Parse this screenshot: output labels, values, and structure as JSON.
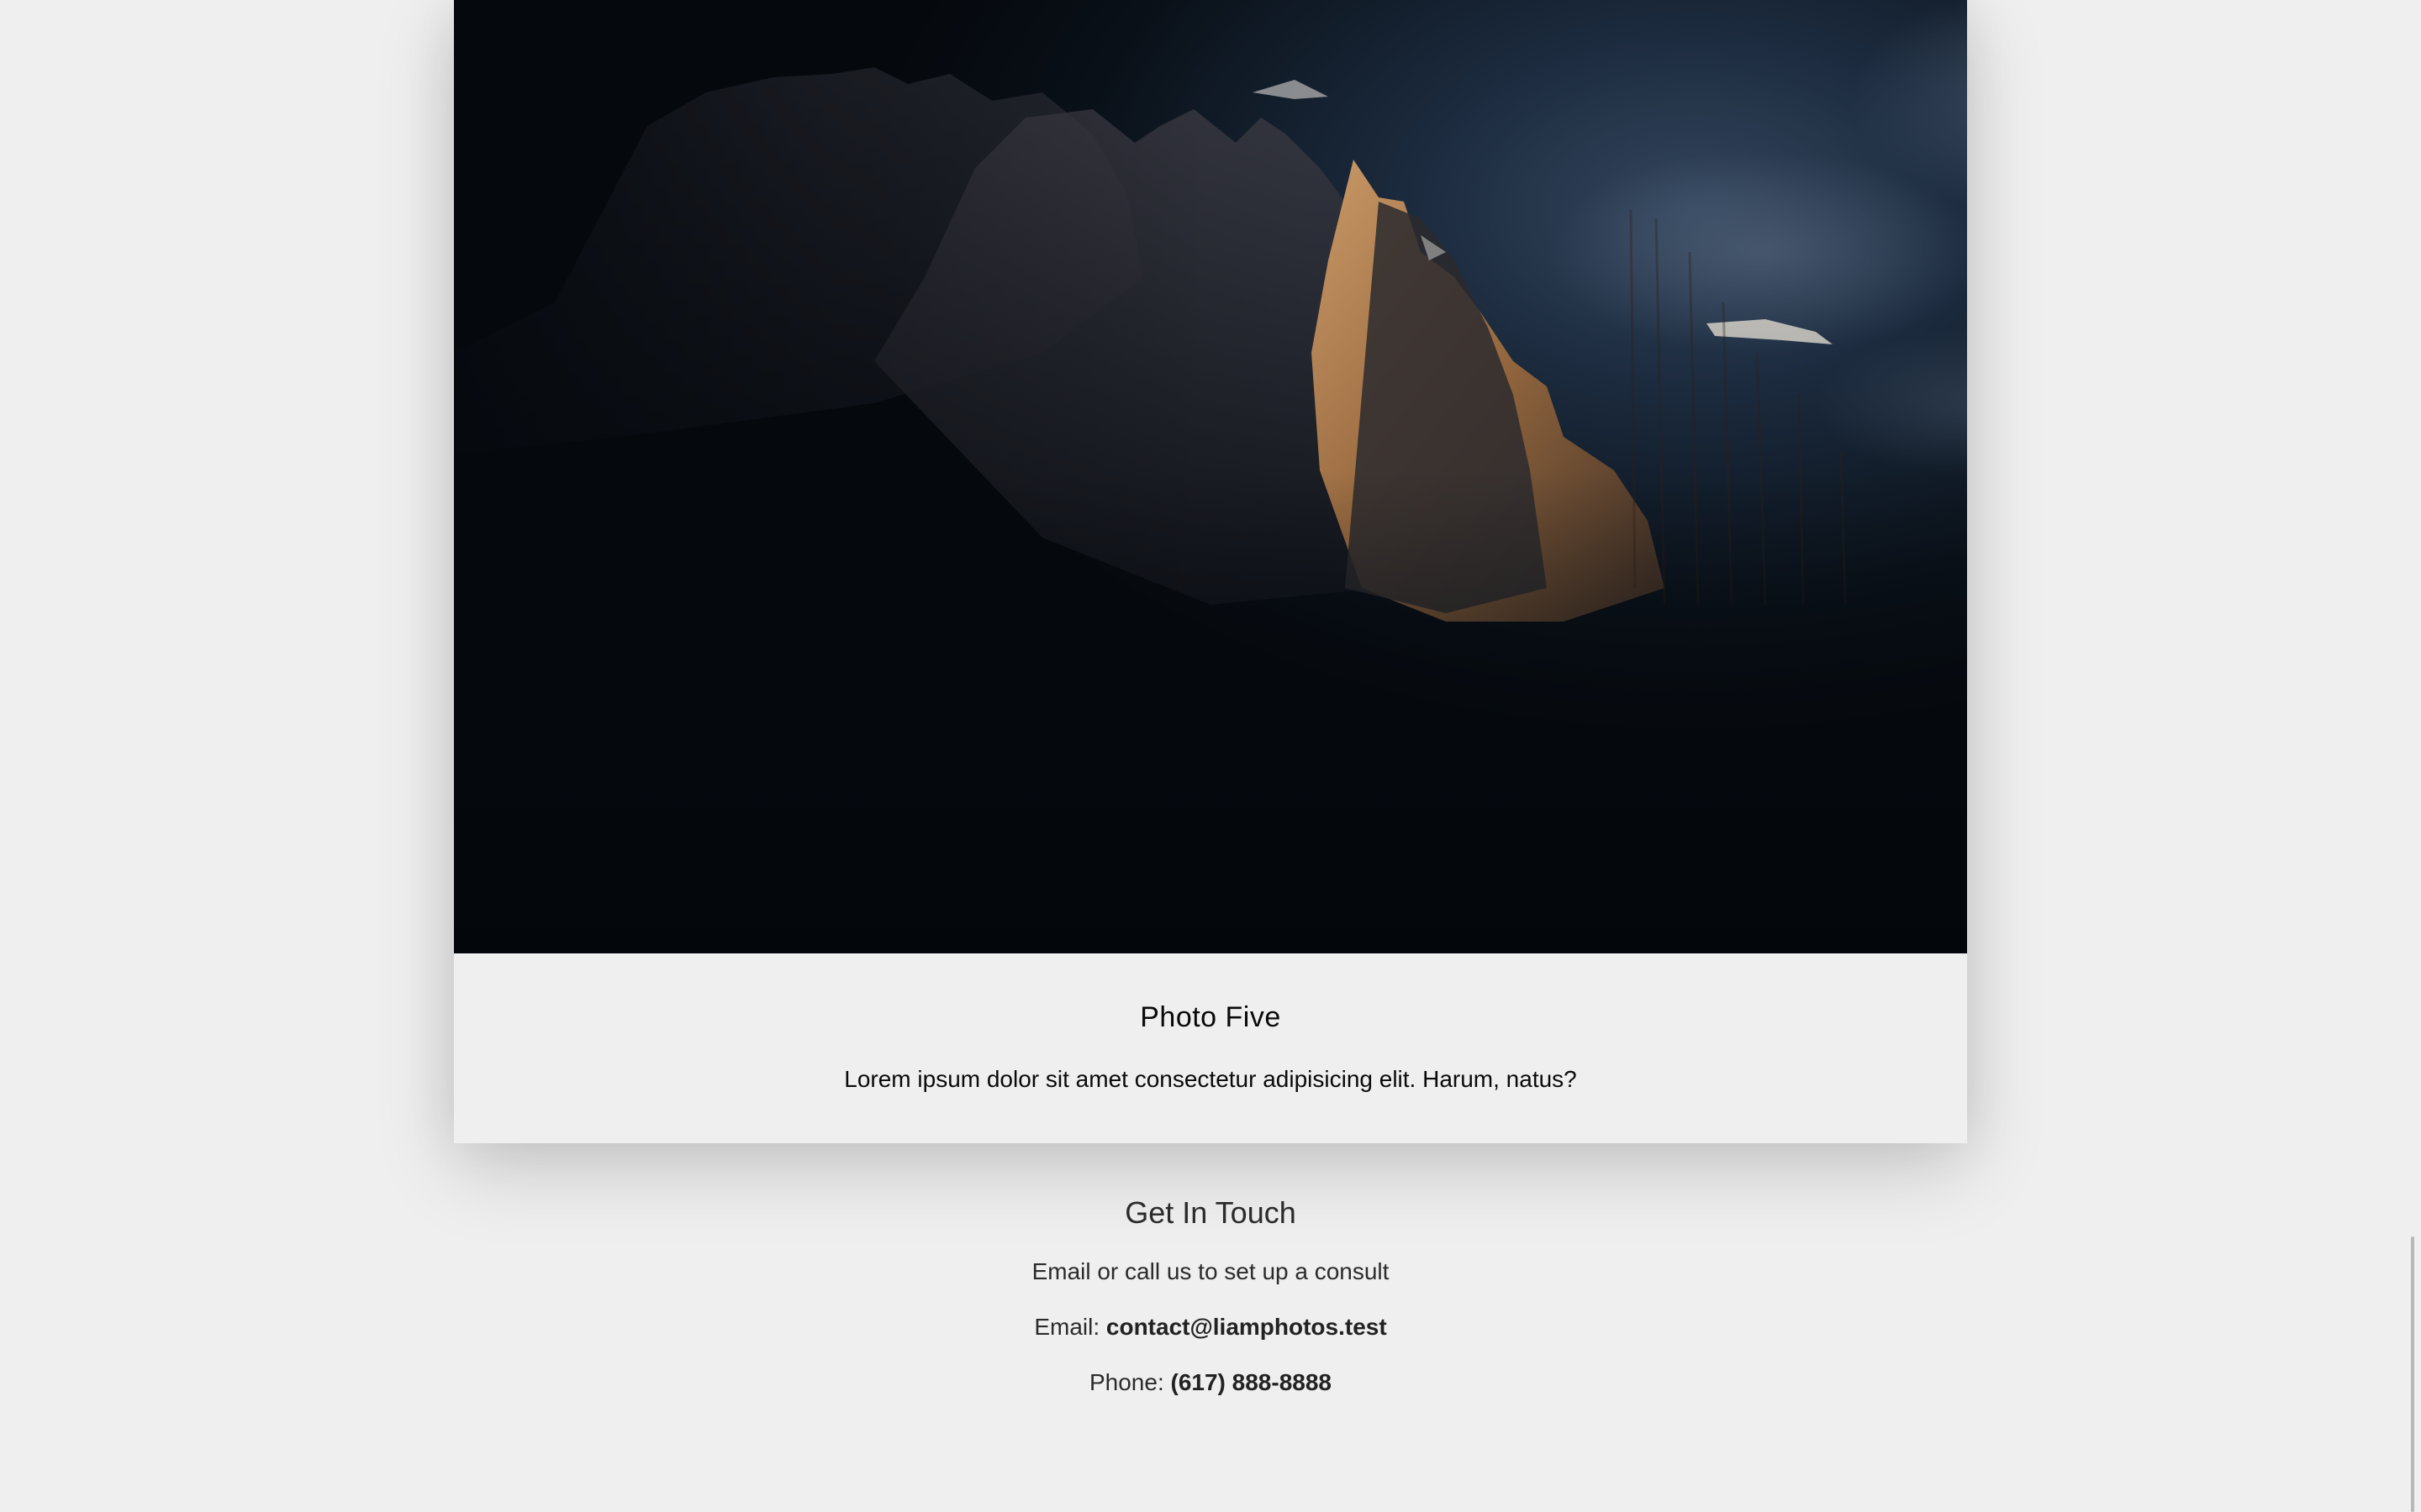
{
  "photo": {
    "icon": "mountain-peak-photo",
    "colors": {
      "sky_dark": "#05090e",
      "sky_blue": "#1d2e44",
      "rock_lit": "#a87a4a",
      "rock_shadow": "#2b2a30"
    }
  },
  "caption": {
    "title": "Photo Five",
    "description": "Lorem ipsum dolor sit amet consectetur adipisicing elit. Harum, natus?"
  },
  "contact": {
    "title": "Get In Touch",
    "subtitle": "Email or call us to set up a consult",
    "email_label": "Email: ",
    "email_value": "contact@liamphotos.test",
    "phone_label": "Phone: ",
    "phone_value": "(617) 888-8888"
  }
}
